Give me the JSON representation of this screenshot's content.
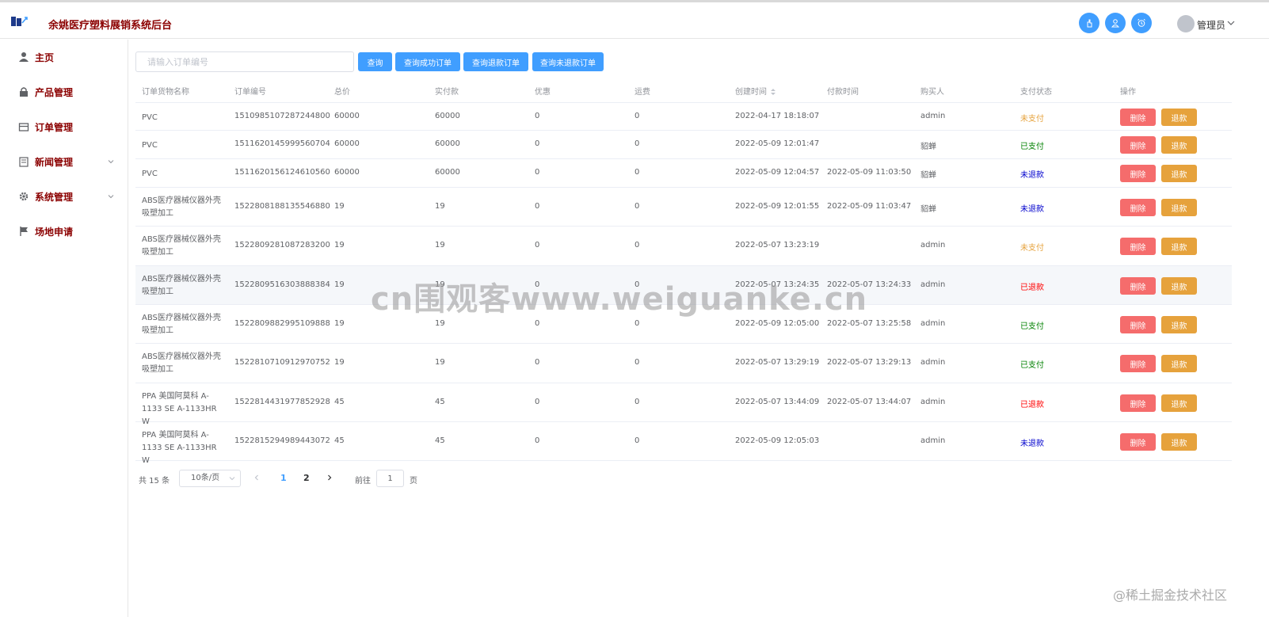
{
  "app": {
    "title": "余姚医疗塑料展销系统后台"
  },
  "header": {
    "user_name": "管理员"
  },
  "colors": {
    "primary": "#409eff",
    "danger": "#f56c6c",
    "warning": "#e6a23c",
    "brand": "#8b0000",
    "status_unpaid": "#e6a23c",
    "status_paid": "#008000",
    "status_not_refunded": "#0000cd",
    "status_refunded": "#ff0000"
  },
  "sidebar": {
    "items": [
      {
        "label": "主页",
        "icon": "user-icon",
        "expandable": false
      },
      {
        "label": "产品管理",
        "icon": "lock-icon",
        "expandable": false
      },
      {
        "label": "订单管理",
        "icon": "tray-icon",
        "expandable": false
      },
      {
        "label": "新闻管理",
        "icon": "document-icon",
        "expandable": true
      },
      {
        "label": "系统管理",
        "icon": "gear-icon",
        "expandable": true
      },
      {
        "label": "场地申请",
        "icon": "flag-icon",
        "expandable": false
      }
    ]
  },
  "toolbar": {
    "search_placeholder": "请输入订单编号",
    "search_value": "",
    "query_label": "查询",
    "query_success_label": "查询成功订单",
    "query_refund_label": "查询退款订单",
    "query_unrefunded_label": "查询未退款订单"
  },
  "table": {
    "headers": [
      "订单货物名称",
      "订单编号",
      "总价",
      "实付款",
      "优惠",
      "运费",
      "创建时间",
      "付款时间",
      "购买人",
      "支付状态",
      "操作"
    ],
    "delete_label": "删除",
    "refund_label": "退款",
    "rows": [
      {
        "name": "PVC",
        "order_no": "1510985107287244800",
        "total": "60000",
        "paid": "60000",
        "discount": "0",
        "freight": "0",
        "created": "2022-04-17 18:18:07",
        "pay_time": "",
        "buyer": "admin",
        "status": "未支付",
        "status_kind": "unpaid"
      },
      {
        "name": "PVC",
        "order_no": "1511620145999560704",
        "total": "60000",
        "paid": "60000",
        "discount": "0",
        "freight": "0",
        "created": "2022-05-09 12:01:47",
        "pay_time": "",
        "buyer": "貂蝉",
        "status": "已支付",
        "status_kind": "paid"
      },
      {
        "name": "PVC",
        "order_no": "1511620156124610560",
        "total": "60000",
        "paid": "60000",
        "discount": "0",
        "freight": "0",
        "created": "2022-05-09 12:04:57",
        "pay_time": "2022-05-09 11:03:50",
        "buyer": "貂蝉",
        "status": "未退款",
        "status_kind": "not_refunded"
      },
      {
        "name": "ABS医疗器械仪器外壳吸塑加工",
        "order_no": "1522808188135546880",
        "total": "19",
        "paid": "19",
        "discount": "0",
        "freight": "0",
        "created": "2022-05-09 12:01:55",
        "pay_time": "2022-05-09 11:03:47",
        "buyer": "貂蝉",
        "status": "未退款",
        "status_kind": "not_refunded"
      },
      {
        "name": "ABS医疗器械仪器外壳吸塑加工",
        "order_no": "1522809281087283200",
        "total": "19",
        "paid": "19",
        "discount": "0",
        "freight": "0",
        "created": "2022-05-07 13:23:19",
        "pay_time": "",
        "buyer": "admin",
        "status": "未支付",
        "status_kind": "unpaid"
      },
      {
        "name": "ABS医疗器械仪器外壳吸塑加工",
        "order_no": "1522809516303888384",
        "total": "19",
        "paid": "19",
        "discount": "0",
        "freight": "0",
        "created": "2022-05-07 13:24:35",
        "pay_time": "2022-05-07 13:24:33",
        "buyer": "admin",
        "status": "已退款",
        "status_kind": "refunded"
      },
      {
        "name": "ABS医疗器械仪器外壳吸塑加工",
        "order_no": "1522809882995109888",
        "total": "19",
        "paid": "19",
        "discount": "0",
        "freight": "0",
        "created": "2022-05-09 12:05:00",
        "pay_time": "2022-05-07 13:25:58",
        "buyer": "admin",
        "status": "已支付",
        "status_kind": "paid"
      },
      {
        "name": "ABS医疗器械仪器外壳吸塑加工",
        "order_no": "1522810710912970752",
        "total": "19",
        "paid": "19",
        "discount": "0",
        "freight": "0",
        "created": "2022-05-07 13:29:19",
        "pay_time": "2022-05-07 13:29:13",
        "buyer": "admin",
        "status": "已支付",
        "status_kind": "paid"
      },
      {
        "name": "PPA 美国阿莫科 A-1133 SE A-1133HR W",
        "order_no": "1522814431977852928",
        "total": "45",
        "paid": "45",
        "discount": "0",
        "freight": "0",
        "created": "2022-05-07 13:44:09",
        "pay_time": "2022-05-07 13:44:07",
        "buyer": "admin",
        "status": "已退款",
        "status_kind": "refunded"
      },
      {
        "name": "PPA 美国阿莫科 A-1133 SE A-1133HR W",
        "order_no": "1522815294989443072",
        "total": "45",
        "paid": "45",
        "discount": "0",
        "freight": "0",
        "created": "2022-05-09 12:05:03",
        "pay_time": "",
        "buyer": "admin",
        "status": "未退款",
        "status_kind": "not_refunded"
      }
    ]
  },
  "pagination": {
    "total_text": "共 15 条",
    "page_size_text": "10条/页",
    "pages": [
      "1",
      "2"
    ],
    "current_page": "1",
    "goto_label": "前往",
    "jump_value": "1",
    "page_suffix": "页"
  },
  "watermarks": {
    "center": "cn围观客www.weiguanke.cn",
    "corner": "@稀土掘金技术社区"
  }
}
